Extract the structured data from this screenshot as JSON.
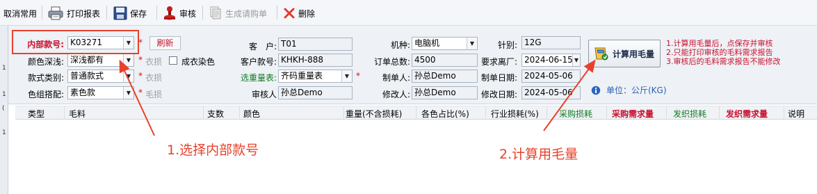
{
  "toolbar": {
    "cancel_common": "取消常用",
    "print_report": "打印报表",
    "save": "保存",
    "review": "审核",
    "generate_request": "生成请购单",
    "delete": "删除"
  },
  "left_strip": [
    "1",
    "1",
    "(",
    "1"
  ],
  "form": {
    "internal_style_label": "内部款号:",
    "internal_style_value": "K03271",
    "refresh_button": "刷新",
    "color_depth_label": "颜色深浅:",
    "color_depth_value": "深浅都有",
    "style_category_label": "款式类别:",
    "style_category_value": "普通款式",
    "color_group_label": "色组搭配:",
    "color_group_value": "素色款",
    "clothing_loss_label": "衣损",
    "garment_dye_label": "成衣染色",
    "clothing_loss2_label": "衣损",
    "wool_loss_label": "毛损",
    "customer_label": "客　户:",
    "customer_value": "T01",
    "customer_style_label": "客户款号:",
    "customer_style_value": "KHKH-888",
    "weight_table_label": "选重量表:",
    "weight_table_value": "齐码重量表",
    "reviewer_label": "审核人",
    "reviewer_value": "孙总Demo",
    "machine_label": "机种:",
    "machine_value": "电脑机",
    "order_total_label": "订单总数:",
    "order_total_value": "4500",
    "creator_label": "制单人:",
    "creator_value": "孙总Demo",
    "modifier_label": "修改人:",
    "modifier_value": "孙总Demo",
    "needle_label": "针别:",
    "needle_value": "12G",
    "required_date_label": "要求离厂:",
    "required_date_value": "2024-06-15",
    "created_date_label": "制单日期:",
    "created_date_value": "2024-05-06",
    "modified_date_label": "修改日期:",
    "modified_date_value": "2024-05-06",
    "calc_button": "计算用毛量",
    "notes": [
      "1.计算用毛量后，点保存并审核",
      "2.只能打印审核的毛料需求报告",
      "3.审核后的毛料需求报告不能修改"
    ],
    "unit_text": "单位：公斤(KG)"
  },
  "table": {
    "headers": [
      "类型",
      "毛料",
      "支数",
      "颜色",
      "重量(不含损耗)",
      "各色占比(%)",
      "行业损耗(%)",
      "采购损耗",
      "采购需求量",
      "发织损耗",
      "发织需求量",
      "说明"
    ]
  },
  "annotations": {
    "step1": "1.选择内部款号",
    "step2": "2.计算用毛量"
  },
  "colors": {
    "annotation_red": "#e8412b",
    "required_red": "#c8102e",
    "label_green": "#107a22",
    "unit_blue": "#2962b0"
  }
}
